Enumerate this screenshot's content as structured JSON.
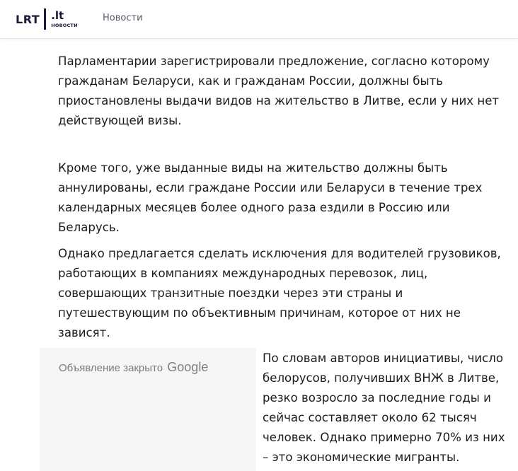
{
  "header": {
    "logo_lrt": "LRT",
    "logo_lt": ".lt",
    "logo_sub": "НОВОСТИ",
    "nav_news": "Новости"
  },
  "article": {
    "paragraphs": [
      "Парламентарии зарегистрировали предложение, согласно которому гражданам Беларуси, как и гражданам России, должны быть приостановлены выдачи видов на жительство в Литве, если у них нет действующей визы.",
      "Кроме того, уже выданные виды на жительство должны быть аннулированы, если граждане России или Беларуси в течение трех календарных месяцев более одного раза ездили в Россию или Беларусь.",
      "Однако предлагается сделать исключения для водителей грузовиков, работающих в компаниях международных перевозок, лиц, совершающих транзитные поездки через эти страны и путешествующим по объективным причинам, которое от них не зависят.",
      "По словам авторов инициативы, число белорусов, получивших ВНЖ в Литве, резко возросло за последние годы и сейчас составляет около 62 тысяч человек. Однако примерно 70% из них – это экономические мигранты."
    ]
  },
  "ad": {
    "closed_text": "Объявление закрыто",
    "brand": "Google"
  },
  "colors": {
    "logo": "#1b1b3a",
    "text": "#1c1c1c",
    "nav": "#555b66",
    "ad_bg": "#f6f6f6"
  }
}
